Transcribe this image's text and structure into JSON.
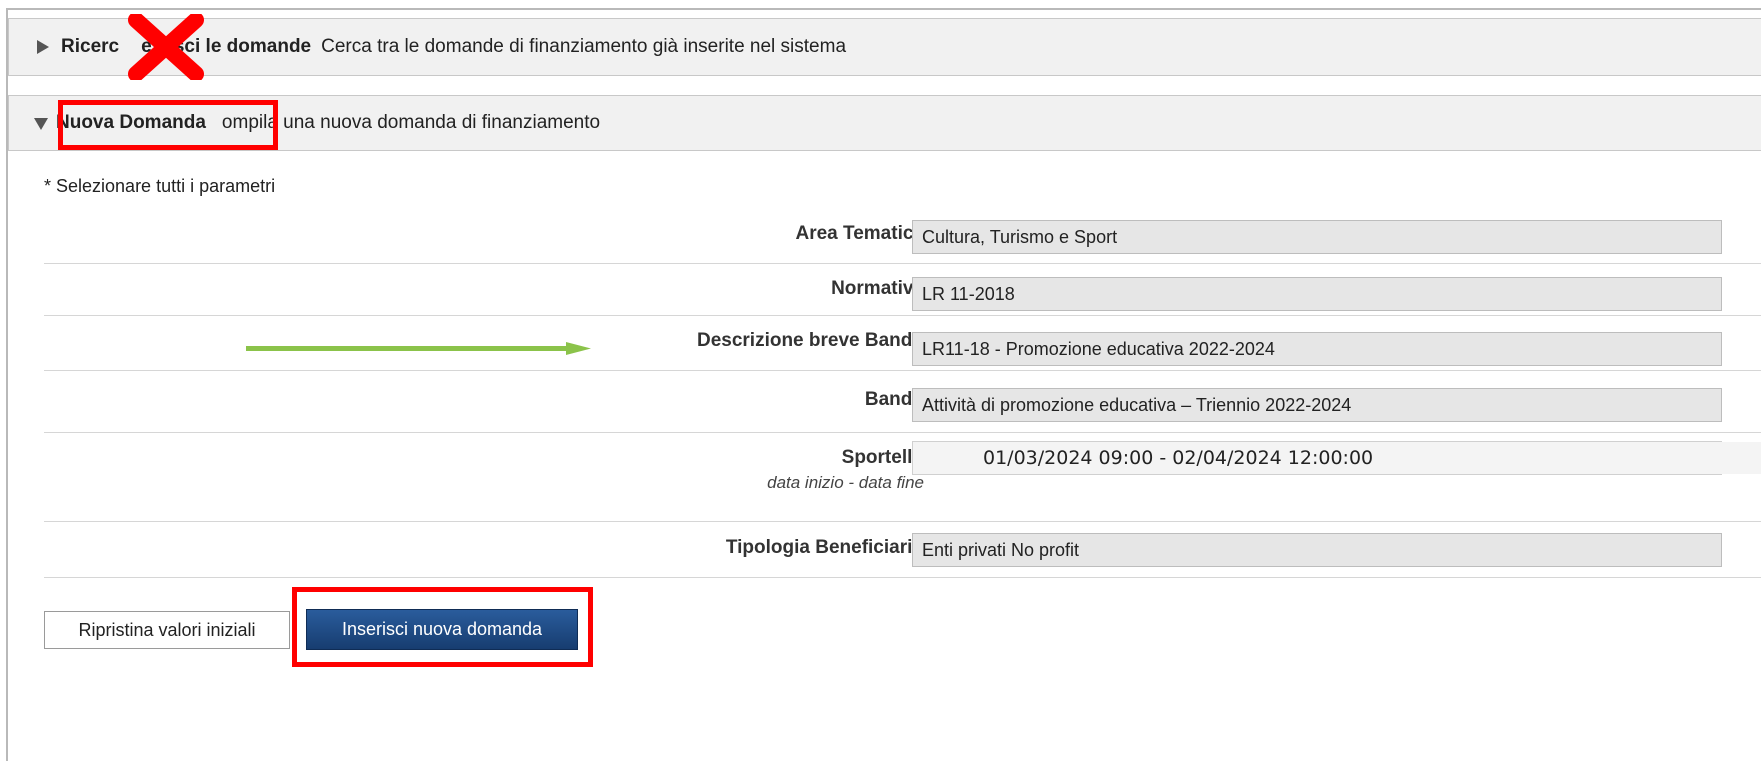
{
  "panels": {
    "search": {
      "title": "Ricerca e gestisci le domande",
      "title_visible": "Ricerc",
      "title_tail": "estisci le domande",
      "description": "Cerca tra le domande di finanziamento già inserite nel sistema"
    },
    "new": {
      "title": "Nuova Domanda",
      "description": "Compila una nuova domanda di finanziamento",
      "description_visible": "ompila una nuova domanda di finanziamento"
    }
  },
  "form": {
    "required_note": "* Selezionare tutti i parametri",
    "fields": [
      {
        "label": "Area Tematica",
        "value": "Cultura, Turismo e Sport"
      },
      {
        "label": "Normativa",
        "value": "LR 11-2018"
      },
      {
        "label": "Descrizione breve Bando",
        "value": "LR11-18 - Promozione educativa 2022-2024"
      },
      {
        "label": "Bando",
        "value": "Attività di promozione educativa – Triennio 2022-2024"
      },
      {
        "label": "Sportello",
        "sublabel": "data inizio - data fine",
        "value": "01/03/2024 09:00 - 02/04/2024  12:00:00"
      },
      {
        "label": "Tipologia Beneficiario",
        "value": "Enti privati No profit"
      }
    ]
  },
  "buttons": {
    "reset": "Ripristina valori iniziali",
    "insert": "Inserisci nuova domanda"
  },
  "colors": {
    "highlight": "#ff0000",
    "arrow": "#8bc34a",
    "primary_button": "#1f4a82"
  },
  "annotations": {
    "cross_icon": "red-x-mark",
    "arrow_icon": "green-arrow-right"
  }
}
